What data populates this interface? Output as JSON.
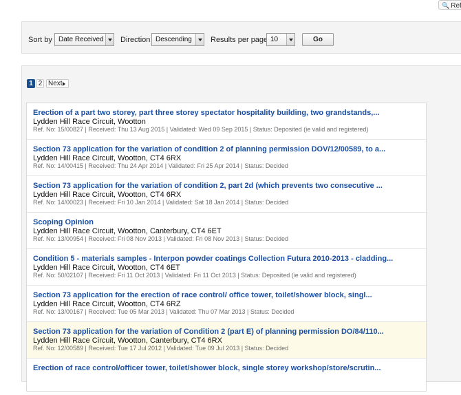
{
  "toolbar": {
    "refine_label": "Ref"
  },
  "sortbar": {
    "sort_by_label": "Sort by",
    "sort_by_value": "Date Received",
    "direction_label": "Direction",
    "direction_value": "Descending",
    "results_label": "Results per page",
    "results_value": "10",
    "go_label": "Go"
  },
  "pager": {
    "current": "1",
    "page2": "2",
    "next_label": "Next"
  },
  "results": [
    {
      "title": "Erection of a part two storey, part three storey spectator hospitality building, two grandstands,...",
      "address": "Lydden Hill Race Circuit, Wootton",
      "meta": "Ref. No: 15/00827 | Received: Thu 13 Aug 2015 | Validated: Wed 09 Sep 2015 | Status: Deposited (ie valid and registered)"
    },
    {
      "title": "Section 73 application for the variation of condition 2 of planning permission DOV/12/00589, to a...",
      "address": "Lydden Hill Race Circuit, Wootton, CT4 6RX",
      "meta": "Ref. No: 14/00415 | Received: Thu 24 Apr 2014 | Validated: Fri 25 Apr 2014 | Status: Decided"
    },
    {
      "title": "Section 73 application for the variation of condition 2, part 2d (which prevents two consecutive ...",
      "address": "Lydden Hill Race Circuit, Wootton, CT4 6RX",
      "meta": "Ref. No: 14/00023 | Received: Fri 10 Jan 2014 | Validated: Sat 18 Jan 2014 | Status: Decided"
    },
    {
      "title": "Scoping Opinion",
      "address": "Lydden Hill Race Circuit, Wootton, Canterbury, CT4 6ET",
      "meta": "Ref. No: 13/00954 | Received: Fri 08 Nov 2013 | Validated: Fri 08 Nov 2013 | Status: Decided"
    },
    {
      "title": "Condition 5 - materials samples - Interpon powder coatings Collection Futura 2010-2013 - cladding...",
      "address": "Lydden Hill Race Circuit, Wootton, CT4 6ET",
      "meta": "Ref. No: 50/02107 | Received: Fri 11 Oct 2013 | Validated: Fri 11 Oct 2013 | Status: Deposited (ie valid and registered)"
    },
    {
      "title": "Section 73 application for the erection of race control/ office tower, toilet/shower block, singl...",
      "address": "Lydden Hill Race Circuit, Wootton, CT4 6RZ",
      "meta": "Ref. No: 13/00167 | Received: Tue 05 Mar 2013 | Validated: Thu 07 Mar 2013 | Status: Decided"
    },
    {
      "title": "Section 73 application for the variation of Condition 2 (part E) of planning permission DO/84/110...",
      "address": "Lydden Hill Race Circuit, Wootton, Canterbury, CT4 6RX",
      "meta": "Ref. No: 12/00589 | Received: Tue 17 Jul 2012 | Validated: Tue 09 Jul 2013 | Status: Decided"
    },
    {
      "title": "Erection of race control/officer tower, toilet/shower block, single storey workshop/store/scrutin...",
      "address": "",
      "meta": ""
    }
  ]
}
